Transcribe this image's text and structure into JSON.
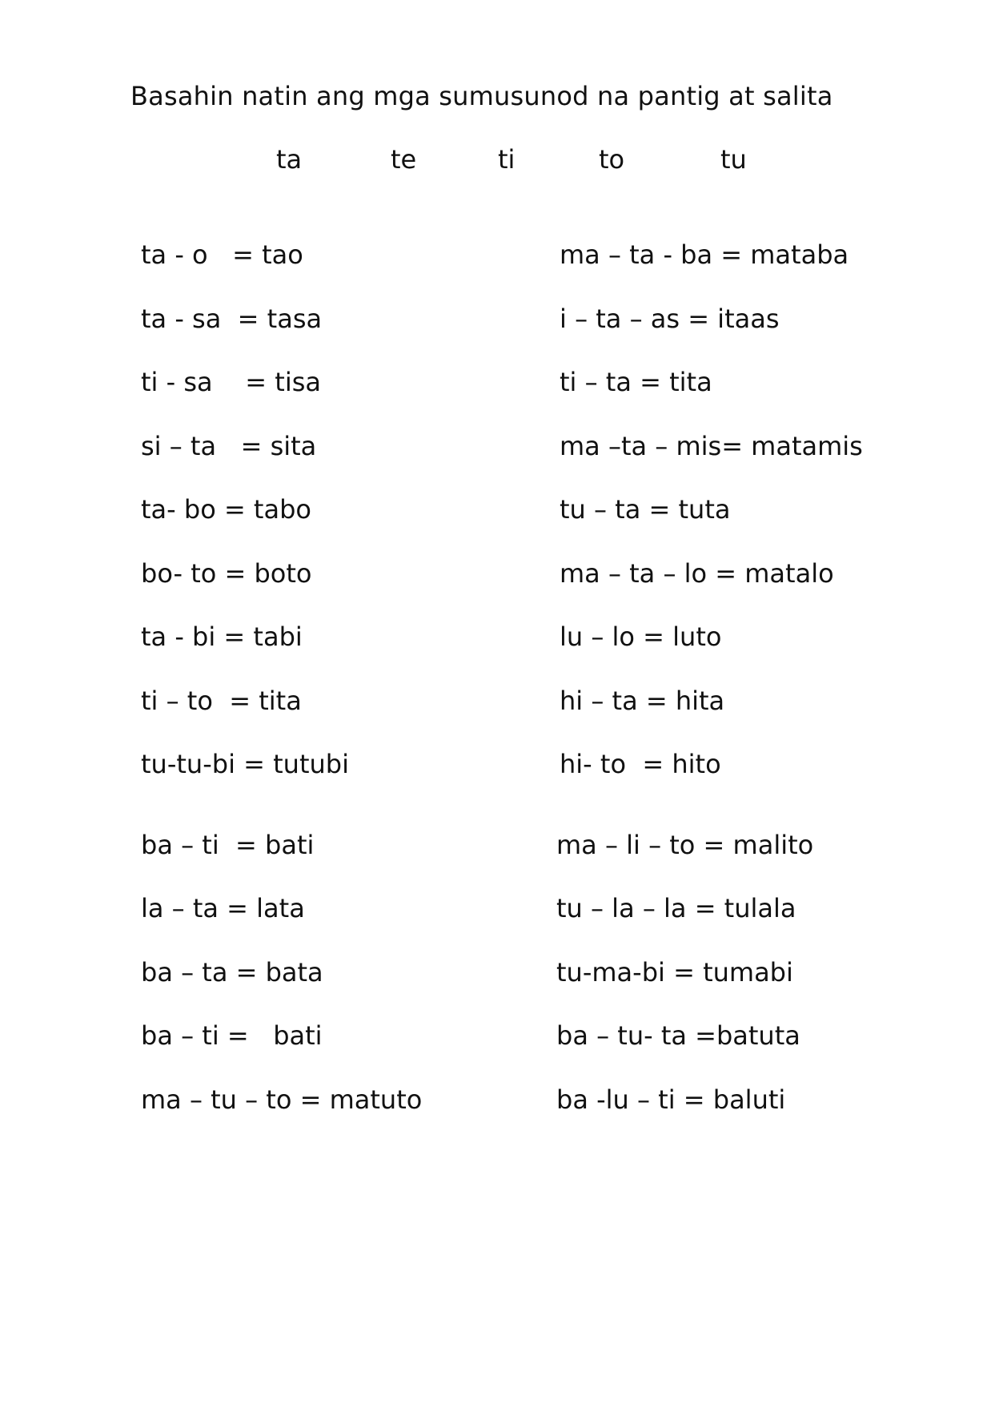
{
  "title": "Basahin natin ang mga sumusunod na pantig at salita",
  "syllables": [
    "ta",
    "te",
    "ti",
    "to",
    "tu"
  ],
  "left_column": [
    "ta - o   = tao",
    "ta - sa  = tasa",
    "ti - sa    = tisa",
    "si – ta   = sita",
    "ta- bo = tabo",
    "bo- to = boto",
    "ta - bi = tabi",
    "ti – to  = tita",
    "tu-tu-bi = tutubi",
    "ba – ti  = bati",
    "la – ta = lata",
    "ba – ta = bata",
    "ba – ti =   bati",
    "ma – tu – to = matuto"
  ],
  "right_column": [
    "ma – ta - ba = mataba",
    "i – ta – as = itaas",
    "ti – ta = tita",
    "ma –ta – mis= matamis",
    "tu – ta = tuta",
    "ma – ta – lo = matalo",
    "lu – lo = luto",
    "hi – ta = hita",
    "hi- to  = hito",
    "ma – li – to = malito",
    "tu – la – la = tulala",
    "tu-ma-bi = tumabi",
    "ba – tu- ta =batuta",
    "ba -lu – ti = baluti"
  ]
}
